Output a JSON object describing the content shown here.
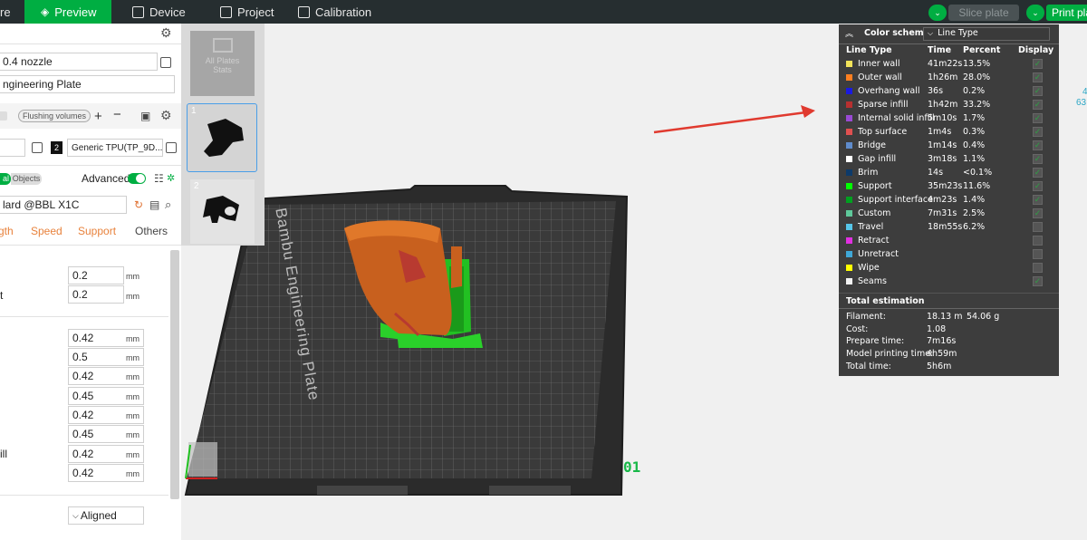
{
  "topbar": {
    "prepare_partial": "re",
    "tabs": [
      {
        "label": "Preview"
      },
      {
        "label": "Device"
      },
      {
        "label": "Project"
      },
      {
        "label": "Calibration"
      }
    ],
    "slice_label": "Slice plate",
    "print_label": "Print pla"
  },
  "left": {
    "nozzle": "0.4 nozzle",
    "plate": "ngineering Plate",
    "flushing": "Flushing volumes",
    "filament_index": "2",
    "filament_name": "Generic TPU(TP_9D...",
    "mode_global": "al",
    "mode_objects": "Objects",
    "advanced": "Advanced",
    "process": "lard @BBL X1C",
    "tabs": [
      "gth",
      "Speed",
      "Support",
      "Others"
    ],
    "layer_values": [
      "0.2",
      "0.2"
    ],
    "layer_suffix": "t",
    "width_values": [
      "0.42",
      "0.5",
      "0.42",
      "0.45",
      "0.42",
      "0.45",
      "0.42",
      "0.42"
    ],
    "width_suffix": "ill",
    "unit": "mm",
    "seam": "Aligned"
  },
  "thumbnails": {
    "all_plates": "All Plates",
    "stats": "Stats",
    "plate1": "1",
    "plate2": "2"
  },
  "viewport": {
    "plate_number": "01",
    "bed_label": "Bambu Engineering Plate",
    "side_text": [
      "4",
      "63"
    ]
  },
  "color_scheme": {
    "title": "Color scheme",
    "selected": "Line Type",
    "headers": [
      "Line Type",
      "Time",
      "Percent",
      "Display"
    ],
    "rows": [
      {
        "name": "Inner wall",
        "time": "41m22s",
        "percent": "13.5%",
        "color": "#f2e35a",
        "checked": true
      },
      {
        "name": "Outer wall",
        "time": "1h26m",
        "percent": "28.0%",
        "color": "#ff7f20",
        "checked": true
      },
      {
        "name": "Overhang wall",
        "time": "36s",
        "percent": "0.2%",
        "color": "#1a1ae0",
        "checked": true
      },
      {
        "name": "Sparse infill",
        "time": "1h42m",
        "percent": "33.2%",
        "color": "#b83030",
        "checked": true
      },
      {
        "name": "Internal solid infill",
        "time": "5m10s",
        "percent": "1.7%",
        "color": "#9a4ad4",
        "checked": true
      },
      {
        "name": "Top surface",
        "time": "1m4s",
        "percent": "0.3%",
        "color": "#e05050",
        "checked": true
      },
      {
        "name": "Bridge",
        "time": "1m14s",
        "percent": "0.4%",
        "color": "#5f8ccc",
        "checked": true
      },
      {
        "name": "Gap infill",
        "time": "3m18s",
        "percent": "1.1%",
        "color": "#ffffff",
        "checked": true
      },
      {
        "name": "Brim",
        "time": "14s",
        "percent": "<0.1%",
        "color": "#0d3a6a",
        "checked": true
      },
      {
        "name": "Support",
        "time": "35m23s",
        "percent": "11.6%",
        "color": "#00ff00",
        "checked": true
      },
      {
        "name": "Support interface",
        "time": "4m23s",
        "percent": "1.4%",
        "color": "#00a020",
        "checked": true
      },
      {
        "name": "Custom",
        "time": "7m31s",
        "percent": "2.5%",
        "color": "#5ec89a",
        "checked": true
      },
      {
        "name": "Travel",
        "time": "18m55s",
        "percent": "6.2%",
        "color": "#56c5e8",
        "checked": false
      },
      {
        "name": "Retract",
        "time": "",
        "percent": "",
        "color": "#e030e0",
        "checked": false
      },
      {
        "name": "Unretract",
        "time": "",
        "percent": "",
        "color": "#3fa8d8",
        "checked": false
      },
      {
        "name": "Wipe",
        "time": "",
        "percent": "",
        "color": "#ffff00",
        "checked": false
      },
      {
        "name": "Seams",
        "time": "",
        "percent": "",
        "color": "#f2f2f2",
        "checked": true
      }
    ],
    "estimation_title": "Total estimation",
    "estimation": [
      {
        "label": "Filament:",
        "value": "18.13 m",
        "extra": "54.06 g"
      },
      {
        "label": "Cost:",
        "value": "1.08",
        "extra": ""
      },
      {
        "label": "Prepare time:",
        "value": "7m16s",
        "extra": ""
      },
      {
        "label": "Model printing time:",
        "value": "4h59m",
        "extra": ""
      },
      {
        "label": "Total time:",
        "value": "5h6m",
        "extra": ""
      }
    ]
  },
  "colors": {
    "accent": "#00ae42",
    "topbar": "#262e30",
    "panel": "#3d3d3d",
    "arrow": "#e03a2f"
  }
}
